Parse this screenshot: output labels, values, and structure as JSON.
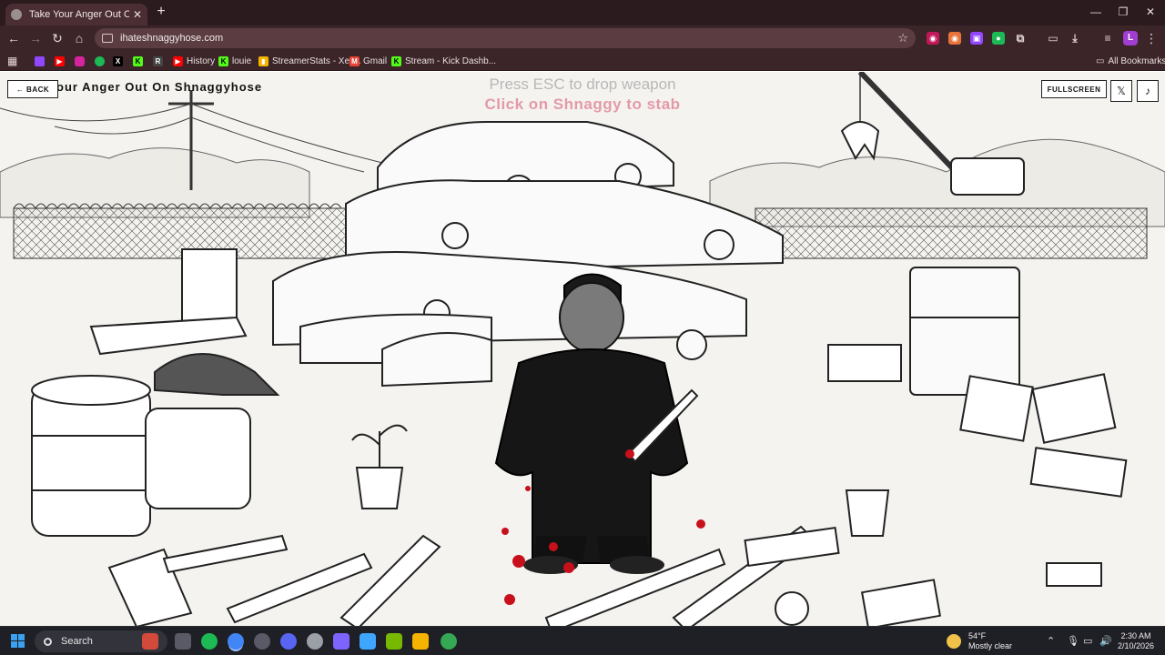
{
  "browser": {
    "tab_title": "Take Your Anger Out On Sh",
    "tab_close": "✕",
    "new_tab": "+",
    "url": "ihateshnaggyhose.com",
    "window_controls": [
      "—",
      "❐",
      "✕"
    ],
    "profile_initial": "L",
    "bookmarks": [
      {
        "label": "",
        "icon": "twitch-icon",
        "color": "#9146ff"
      },
      {
        "label": "",
        "icon": "youtube-icon",
        "color": "#ff0000"
      },
      {
        "label": "",
        "icon": "instagram-icon",
        "color": "#d6249f"
      },
      {
        "label": "",
        "icon": "spotify-icon",
        "color": "#1db954"
      },
      {
        "label": "",
        "icon": "x-icon",
        "color": "#000000"
      },
      {
        "label": "",
        "icon": "kick-icon",
        "color": "#53fc18"
      },
      {
        "label": "",
        "icon": "roblox-icon",
        "color": "#444444"
      },
      {
        "label": "History",
        "icon": "youtube-icon",
        "color": "#ff0000"
      },
      {
        "label": "louie",
        "icon": "kick-icon",
        "color": "#53fc18"
      },
      {
        "label": "StreamerStats - Xev...",
        "icon": "chart-icon",
        "color": "#f4b400"
      },
      {
        "label": "Gmail",
        "icon": "gmail-icon",
        "color": "#ea4335"
      },
      {
        "label": "Stream - Kick Dashb...",
        "icon": "kick-icon",
        "color": "#53fc18"
      }
    ],
    "all_bookmarks": "All Bookmarks"
  },
  "page": {
    "back_label": "← BACK",
    "title": "our Anger Out On Shnaggyhose",
    "esc_hint": "Press ESC to drop weapon",
    "stab_hint": "Click on Shnaggy to stab",
    "fullscreen_label": "FULLSCREEN",
    "x_label": "𝕏",
    "music_label": "♪"
  },
  "taskbar": {
    "search_label": "Search",
    "weather_temp": "54°F",
    "weather_desc": "Mostly clear",
    "time": "2:30 AM",
    "date": "2/10/2026",
    "app_colors": [
      "#d34a3a",
      "#5a5a66",
      "#1db954",
      "#4285f4",
      "#5a5a66",
      "#5865f2",
      "#9aa0a6",
      "#7d64ff",
      "#3ea6ff",
      "#76b900",
      "#f4b400",
      "#34a853"
    ]
  }
}
